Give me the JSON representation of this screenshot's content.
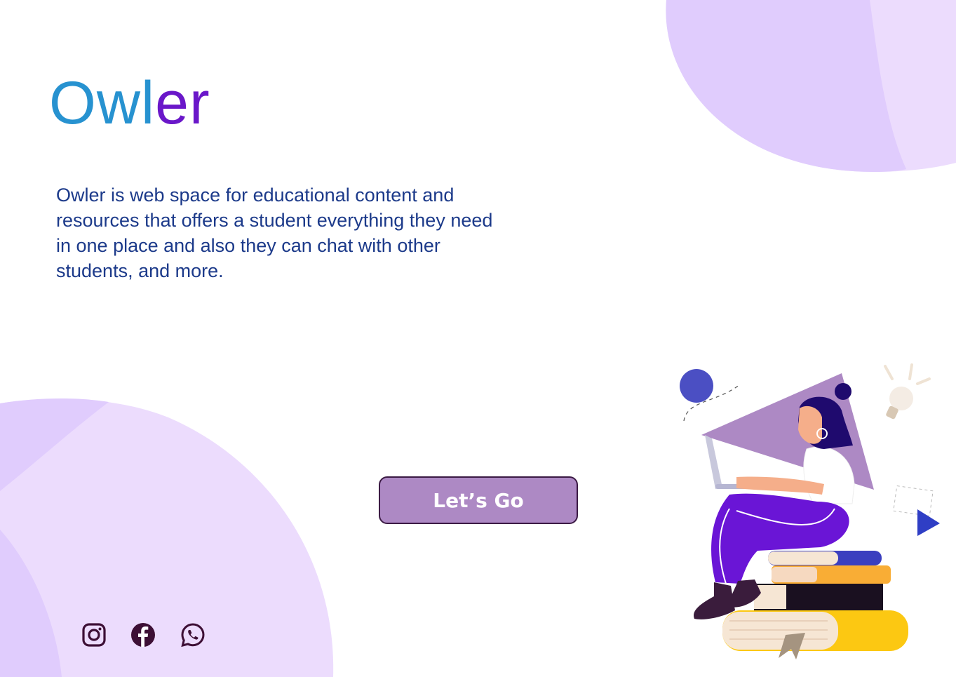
{
  "brand": {
    "logo_part1": "Owl",
    "logo_part2": "er"
  },
  "hero": {
    "description": "Owler is web space for educational content and resources that offers a student everything they need in one place and also they can chat with other students, and more.",
    "cta_label": "Let’s Go"
  },
  "social_links": [
    {
      "icon": "instagram-icon"
    },
    {
      "icon": "facebook-icon"
    },
    {
      "icon": "whatsapp-icon"
    }
  ],
  "colors": {
    "logo_blue": "#2792d0",
    "logo_purple": "#6a17c9",
    "text_navy": "#1c3a8a",
    "button_fill": "#ad89c4",
    "button_border": "#3b1a44",
    "blob_light": "#ecdcfd",
    "blob_mid": "#e0ccfd",
    "social_icon": "#3d0f35"
  }
}
